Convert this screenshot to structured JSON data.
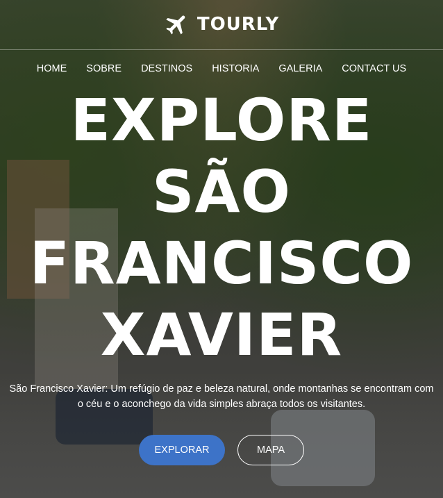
{
  "brand": {
    "name": "TOURLY",
    "icon": "airplane-icon"
  },
  "nav": [
    "HOME",
    "SOBRE",
    "DESTINOS",
    "HISTORIA",
    "GALERIA",
    "CONTACT US"
  ],
  "hero": {
    "title_lines": [
      "EXPLORE",
      "SÃO",
      "FRANCISCO",
      "XAVIER"
    ],
    "description_lines": [
      "São Francisco Xavier: Um refúgio de paz e beleza natural, onde montanhas se encontram com",
      "o céu e o aconchego da vida simples abraça todos os visitantes."
    ]
  },
  "buttons": {
    "primary": "EXPLORAR",
    "secondary": "MAPA"
  },
  "colors": {
    "accent": "#3d73c8",
    "text": "#ffffff"
  }
}
